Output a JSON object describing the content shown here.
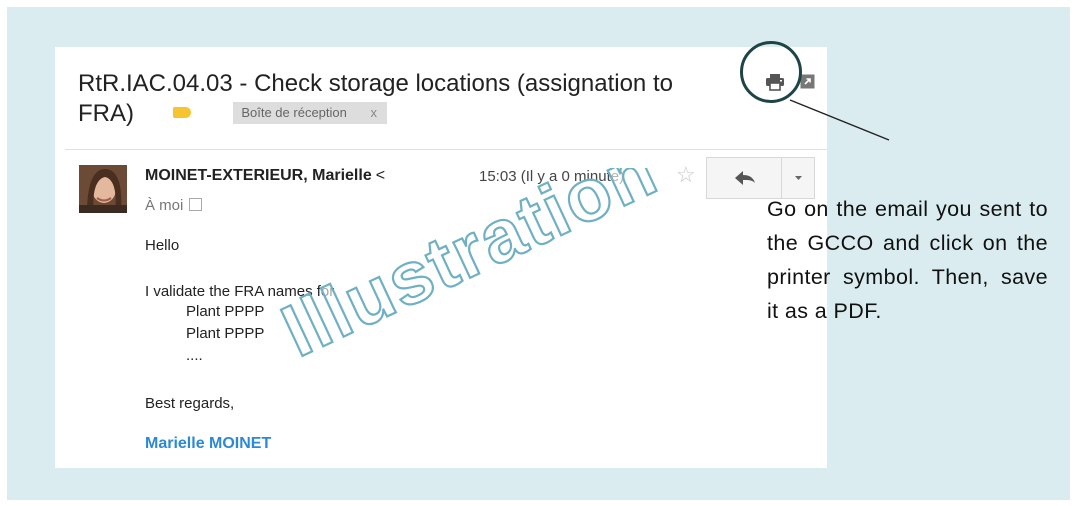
{
  "email": {
    "subject_line1": "RtR.IAC.04.03 - Check storage locations (assignation to",
    "subject_line2": "FRA)",
    "label": "Boîte de réception",
    "label_remove": "x",
    "sender": "MOINET-EXTERIEUR, Marielle",
    "sender_suffix": "<",
    "time": "15:03 (Il y a 0 minute)",
    "recipient": "À moi",
    "body": {
      "greeting": "Hello",
      "line1": "I validate the FRA names for",
      "line2": "Plant PPPP",
      "line3": "Plant PPPP",
      "line4": "....",
      "closing": "Best regards,"
    },
    "signature": "Marielle MOINET"
  },
  "icons": {
    "tag": "label-tag-icon",
    "print": "printer-icon",
    "popout": "open-in-new-window-icon",
    "star": "star-icon",
    "reply": "reply-arrow-icon",
    "more": "chevron-down-icon"
  },
  "watermark": "Illustration",
  "instruction": "Go on the email you sent to the GCCO and click on the printer symbol. Then, save it as a PDF.",
  "colors": {
    "slide_background": "#daecef",
    "callout_circle": "#1f4448",
    "signature": "#2a8ad6",
    "tag": "#f6c431",
    "watermark_outline": "#6fb0c4"
  }
}
